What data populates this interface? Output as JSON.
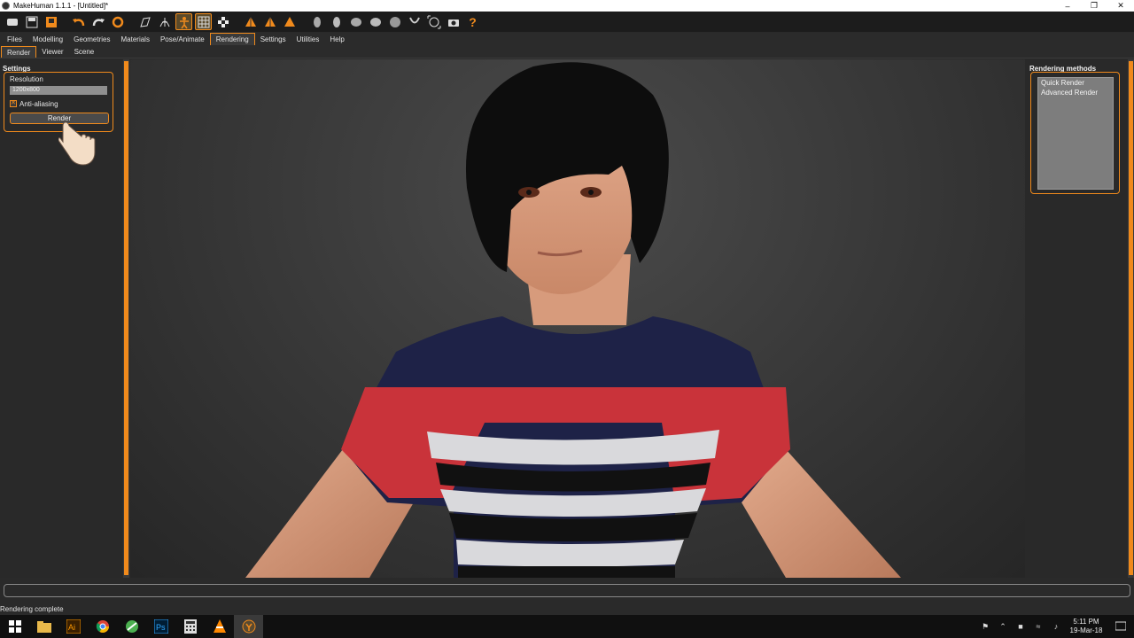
{
  "window": {
    "title": "MakeHuman 1.1.1 - [Untitled]*"
  },
  "menu": {
    "tabs": [
      "Files",
      "Modelling",
      "Geometries",
      "Materials",
      "Pose/Animate",
      "Rendering",
      "Settings",
      "Utilities",
      "Help"
    ],
    "active": "Rendering"
  },
  "subtabs": {
    "tabs": [
      "Render",
      "Viewer",
      "Scene"
    ],
    "active": "Render"
  },
  "settings": {
    "title": "Settings",
    "resolution_label": "Resolution",
    "resolution_value": "1200x800",
    "antialias_label": "Anti-aliasing",
    "antialias_checked": true,
    "render_button": "Render"
  },
  "rendering_methods": {
    "title": "Rendering methods",
    "items": [
      "Quick Render",
      "Advanced Render"
    ]
  },
  "status": {
    "text": "Rendering complete",
    "progress": 0
  },
  "clock": {
    "time": "5:11 PM",
    "date": "19-Mar-18"
  },
  "colors": {
    "accent": "#f08a1c",
    "panel": "#292929",
    "viewport": "#3a3a3a"
  }
}
